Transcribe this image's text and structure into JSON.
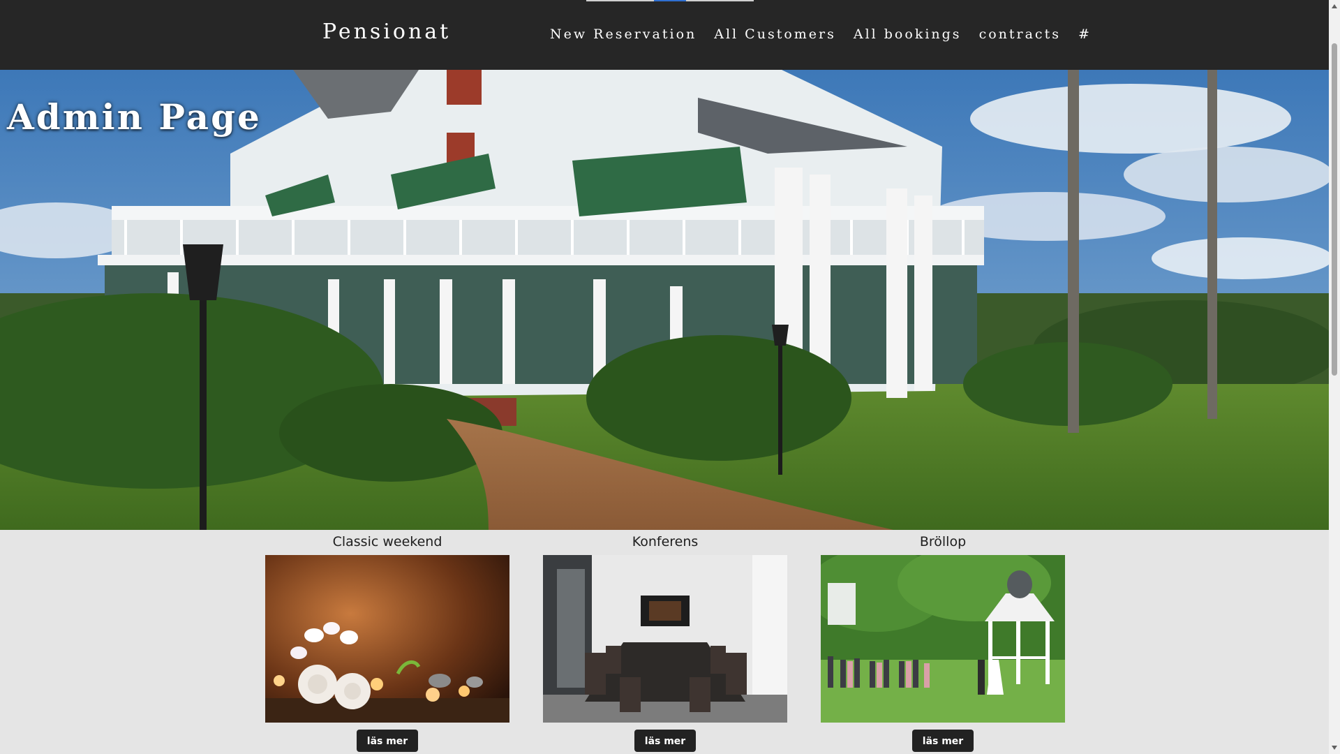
{
  "navbar": {
    "brand": "Pensionat",
    "links": [
      {
        "label": "New Reservation"
      },
      {
        "label": "All Customers"
      },
      {
        "label": "All bookings"
      },
      {
        "label": "contracts"
      },
      {
        "label": "#"
      }
    ]
  },
  "hero": {
    "title": "Admin Page",
    "image": "victorian-mansion-photo"
  },
  "cards": [
    {
      "title": "Classic weekend",
      "image": "spa-towels-candles-orchids-photo",
      "button_label": "läs mer"
    },
    {
      "title": "Konferens",
      "image": "conference-room-photo",
      "button_label": "läs mer"
    },
    {
      "title": "Bröllop",
      "image": "wedding-gazebo-photo",
      "button_label": "läs mer"
    }
  ],
  "colors": {
    "navbar_bg": "#262626",
    "page_bg": "#e5e5e5",
    "button_bg": "#222222",
    "text_light": "#ffffff"
  }
}
